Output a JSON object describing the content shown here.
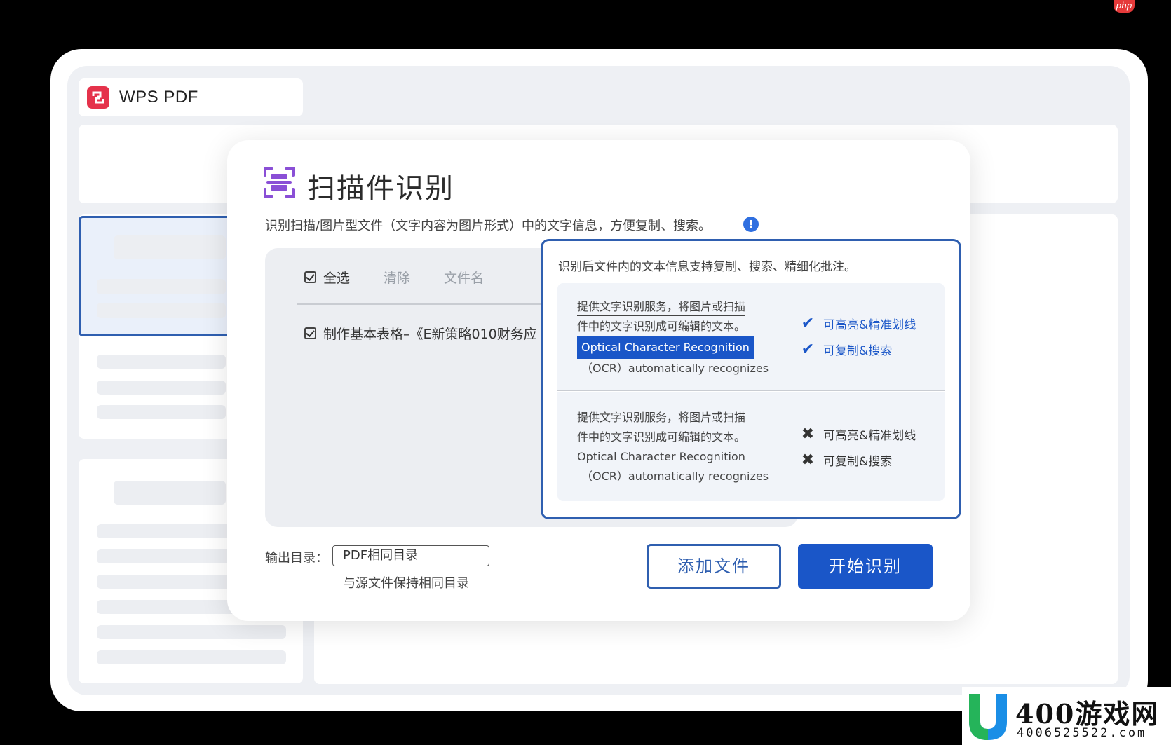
{
  "app": {
    "name": "WPS PDF"
  },
  "dialog": {
    "title": "扫描件识别",
    "description": "识别扫描/图片型文件（文字内容为图片形式）中的文字信息，方便复制、搜索。",
    "info_icon": "!",
    "toolbar": {
      "select_all": "全选",
      "clear": "清除",
      "file_name": "文件名"
    },
    "files": [
      {
        "name": "制作基本表格–《E新策略010财务应"
      }
    ],
    "output": {
      "label": "输出目录：",
      "value": "PDF相同目录",
      "hint": "与源文件保持相同目录"
    },
    "buttons": {
      "add_file": "添加文件",
      "start": "开始识别"
    }
  },
  "popup": {
    "header": "识别后文件内的文本信息支持复制、搜索、精细化批注。",
    "ocr_on": {
      "line1": "提供文字识别服务，将图片或扫描",
      "line2": "件中的文字识别成可编辑的文本。",
      "line3": "Optical Character Recognition",
      "line4": "（OCR）automatically recognizes",
      "features": [
        "可高亮&精准划线",
        "可复制&搜索"
      ],
      "mark": "✔"
    },
    "ocr_off": {
      "line1": "提供文字识别服务，将图片或扫描",
      "line2": "件中的文字识别成可编辑的文本。",
      "line3": "Optical Character Recognition",
      "line4": "（OCR）automatically recognizes",
      "features": [
        "可高亮&精准划线",
        "可复制&搜索"
      ],
      "mark": "✖"
    }
  },
  "watermark": {
    "badge": "php",
    "site_name": "400游戏网",
    "site_url": "4006525522.com"
  },
  "colors": {
    "accent": "#1a56c8",
    "border_blue": "#2f5fb0",
    "brand_red": "#e5324b"
  }
}
